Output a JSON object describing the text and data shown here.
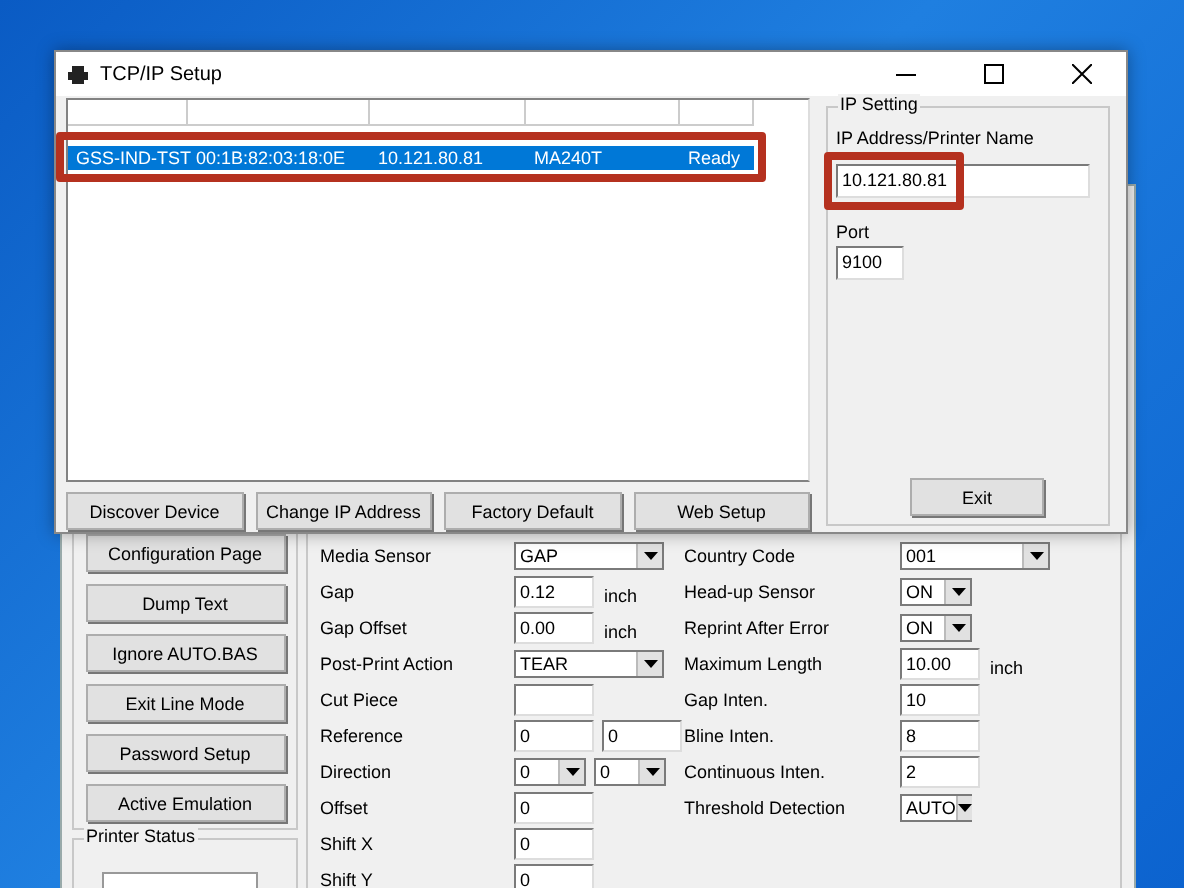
{
  "dialog": {
    "title": "TCP/IP Setup",
    "devices": [
      {
        "cells": [
          "GSS-IND-TST",
          "00:1B:82:03:18:0E",
          "10.121.80.81",
          "MA240T",
          "Ready"
        ],
        "selected": true,
        "highlighted": true
      }
    ],
    "buttons": [
      "Discover Device",
      "Change IP Address",
      "Factory Default",
      "Web Setup"
    ],
    "ip_setting": {
      "title": "IP Setting",
      "address_label": "IP Address/Printer Name",
      "address": "10.121.80.81",
      "address_highlighted": true,
      "port_label": "Port",
      "port": "9100"
    },
    "exit_button": "Exit"
  },
  "main_window": {
    "side_buttons": [
      "Configuration Page",
      "Dump Text",
      "Ignore AUTO.BAS",
      "Exit Line Mode",
      "Password Setup",
      "Active Emulation"
    ],
    "printer_status": {
      "title": "Printer Status"
    },
    "left_rows": [
      {
        "label": "Media Sensor",
        "fields": [
          {
            "kind": "combobox",
            "value": "GAP"
          }
        ]
      },
      {
        "label": "Gap",
        "fields": [
          {
            "kind": "textbox",
            "value": "0.12"
          }
        ],
        "unit": "inch"
      },
      {
        "label": "Gap Offset",
        "fields": [
          {
            "kind": "textbox",
            "value": "0.00"
          }
        ],
        "unit": "inch"
      },
      {
        "label": "Post-Print Action",
        "fields": [
          {
            "kind": "combobox",
            "value": "TEAR"
          }
        ]
      },
      {
        "label": "Cut Piece",
        "fields": [
          {
            "kind": "textbox"
          }
        ]
      },
      {
        "label": "Reference",
        "fields": [
          {
            "kind": "textbox",
            "value": "0"
          },
          {
            "kind": "textbox",
            "value": "0"
          }
        ]
      },
      {
        "label": "Direction",
        "fields": [
          {
            "kind": "dropdown",
            "value": "0"
          },
          {
            "kind": "dropdown",
            "value": "0"
          }
        ]
      },
      {
        "label": "Offset",
        "fields": [
          {
            "kind": "textbox",
            "value": "0"
          }
        ]
      },
      {
        "label": "Shift X",
        "fields": [
          {
            "kind": "textbox",
            "value": "0"
          }
        ]
      },
      {
        "label": "Shift Y",
        "fields": [
          {
            "kind": "textbox",
            "value": "0"
          }
        ]
      }
    ],
    "right_rows": [
      {
        "label": "Country Code",
        "fields": [
          {
            "kind": "combobox",
            "value": "001"
          }
        ]
      },
      {
        "label": "Head-up Sensor",
        "fields": [
          {
            "kind": "dropdown",
            "value": "ON"
          }
        ]
      },
      {
        "label": "Reprint After Error",
        "fields": [
          {
            "kind": "dropdown",
            "value": "ON"
          }
        ]
      },
      {
        "label": "Maximum Length",
        "fields": [
          {
            "kind": "textbox",
            "value": "10.00"
          }
        ],
        "unit": "inch"
      },
      {
        "label": "Gap Inten.",
        "fields": [
          {
            "kind": "textbox",
            "value": "10"
          }
        ]
      },
      {
        "label": "Bline Inten.",
        "fields": [
          {
            "kind": "textbox",
            "value": "8"
          }
        ]
      },
      {
        "label": "Continuous Inten.",
        "fields": [
          {
            "kind": "textbox",
            "value": "2"
          }
        ]
      },
      {
        "label": "Threshold Detection",
        "fields": [
          {
            "kind": "dropdown",
            "value": "AUTO"
          }
        ]
      }
    ]
  }
}
